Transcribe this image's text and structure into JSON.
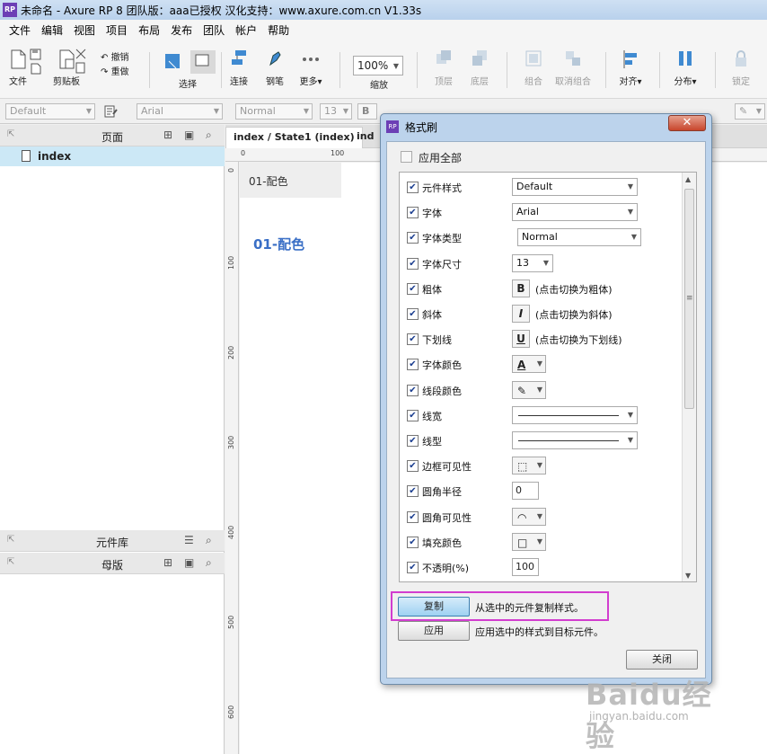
{
  "window": {
    "title": "未命名 - Axure RP 8 团队版：aaa已授权 汉化支持：www.axure.com.cn V1.33s",
    "logo_text": "RP"
  },
  "menu": [
    "文件",
    "编辑",
    "视图",
    "项目",
    "布局",
    "发布",
    "团队",
    "帐户",
    "帮助"
  ],
  "toolbar": {
    "file": "文件",
    "clipboard": "剪贴板",
    "undo": "撤销",
    "redo": "重做",
    "select": "选择",
    "connect": "连接",
    "pen": "钢笔",
    "more": "更多▾",
    "zoom_value": "100%",
    "zoom_label": "缩放",
    "top": "顶层",
    "bottom": "底层",
    "group": "组合",
    "ungroup": "取消组合",
    "align": "对齐▾",
    "distribute": "分布▾",
    "lock": "锁定"
  },
  "formatbar": {
    "style": "Default",
    "font": "Arial",
    "weight": "Normal",
    "size": "13"
  },
  "pages_panel": {
    "title": "页面",
    "pages": [
      "index"
    ]
  },
  "widgets_panel": {
    "title": "元件库"
  },
  "masters_panel": {
    "title": "母版"
  },
  "canvas": {
    "tab_active": "index / State1 (index)",
    "tab_second": "ind",
    "ruler_h": [
      "0",
      "100"
    ],
    "ruler_v": [
      "0",
      "100",
      "200",
      "300",
      "400",
      "500",
      "600"
    ],
    "note_text": "01-配色",
    "heading_text": "01-配色"
  },
  "dialog": {
    "title": "格式刷",
    "close_x": "✕",
    "apply_all": "应用全部",
    "properties": [
      {
        "label": "元件样式",
        "checked": true,
        "control": "select",
        "value": "Default"
      },
      {
        "label": "字体",
        "checked": true,
        "control": "select",
        "value": "Arial"
      },
      {
        "label": "字体类型",
        "checked": true,
        "control": "select",
        "value": "Normal"
      },
      {
        "label": "字体尺寸",
        "checked": true,
        "control": "select_small",
        "value": "13"
      },
      {
        "label": "粗体",
        "checked": true,
        "control": "button",
        "button": "B",
        "hint": "(点击切换为粗体)"
      },
      {
        "label": "斜体",
        "checked": true,
        "control": "button",
        "button": "I",
        "hint": "(点击切换为斜体)"
      },
      {
        "label": "下划线",
        "checked": true,
        "control": "button",
        "button": "U",
        "hint": "(点击切换为下划线)"
      },
      {
        "label": "字体颜色",
        "checked": true,
        "control": "color",
        "swatch": "A"
      },
      {
        "label": "线段颜色",
        "checked": true,
        "control": "color",
        "swatch": "✎"
      },
      {
        "label": "线宽",
        "checked": true,
        "control": "line"
      },
      {
        "label": "线型",
        "checked": true,
        "control": "line"
      },
      {
        "label": "边框可见性",
        "checked": true,
        "control": "color",
        "swatch": "⬚"
      },
      {
        "label": "圆角半径",
        "checked": true,
        "control": "input",
        "value": "0"
      },
      {
        "label": "圆角可见性",
        "checked": true,
        "control": "color",
        "swatch": "◠"
      },
      {
        "label": "填充颜色",
        "checked": true,
        "control": "color",
        "swatch": "□"
      },
      {
        "label": "不透明(%)",
        "checked": true,
        "control": "input",
        "value": "100"
      }
    ],
    "copy_button": "复制",
    "copy_desc": "从选中的元件复制样式。",
    "apply_button": "应用",
    "apply_desc": "应用选中的样式到目标元件。",
    "close_button": "关闭"
  },
  "watermark": {
    "text": "Baidu经验",
    "url": "jingyan.baidu.com"
  },
  "colors": {
    "highlight_border": "#d23dcf",
    "heading_blue": "#3a6fc6",
    "selected_row": "#cce8f6",
    "copy_button": "#9ed1f2"
  }
}
